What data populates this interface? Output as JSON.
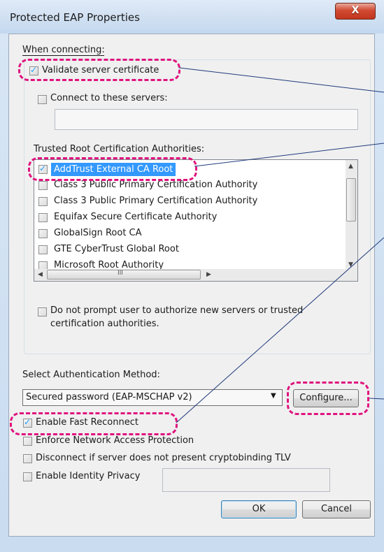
{
  "window": {
    "title": "Protected EAP Properties",
    "close_label": "X"
  },
  "when_connecting": "When connecting:",
  "validate_label": "Validate server certificate",
  "connect_label": "Connect to these servers:",
  "servers_value": "",
  "trusted_label": "Trusted Root Certification Authorities:",
  "cas": [
    {
      "label": "AddTrust External CA Root",
      "checked": true,
      "selected": true
    },
    {
      "label": "Class 3 Public Primary Certification Authority",
      "checked": false
    },
    {
      "label": "Class 3 Public Primary Certification Authority",
      "checked": false
    },
    {
      "label": "Equifax Secure Certificate Authority",
      "checked": false
    },
    {
      "label": "GlobalSign Root CA",
      "checked": false
    },
    {
      "label": "GTE CyberTrust Global Root",
      "checked": false
    },
    {
      "label": "Microsoft Root Authority",
      "checked": false
    }
  ],
  "scroll_grip": "III",
  "noprompt_line1": "Do not prompt user to authorize new servers or trusted",
  "noprompt_line2": "certification authorities.",
  "auth_label": "Select Authentication Method:",
  "auth_method": "Secured password (EAP-MSCHAP v2)",
  "configure_label": "Configure...",
  "fast_reconnect": "Enable Fast Reconnect",
  "enforce_nap": "Enforce Network Access Protection",
  "disconnect_crypto": "Disconnect if server does not present cryptobinding TLV",
  "identity_privacy": "Enable Identity Privacy",
  "identity_value": "",
  "ok_label": "OK",
  "cancel_label": "Cancel",
  "colors": {
    "highlight": "#e0137e",
    "selection": "#3399ff",
    "line": "#1f3a7a"
  }
}
